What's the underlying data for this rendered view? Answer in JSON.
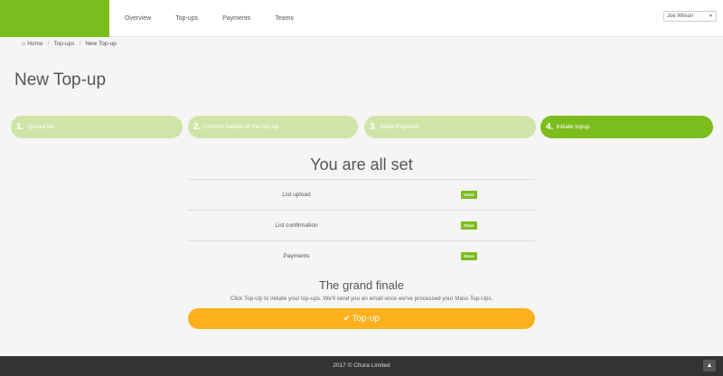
{
  "nav": {
    "items": [
      "Overview",
      "Top-ups",
      "Payments",
      "Teams"
    ]
  },
  "user": {
    "name": "Joe Wilson"
  },
  "breadcrumb": {
    "home": "Home",
    "section": "Top-ups",
    "current": "New Top-up"
  },
  "page": {
    "title": "New Top-up"
  },
  "steps": [
    {
      "num": "1.",
      "label": "Upload list"
    },
    {
      "num": "2.",
      "label": "Confirm Details of the top-up"
    },
    {
      "num": "3.",
      "label": "Make Payment"
    },
    {
      "num": "4.",
      "label": "Initiate topup"
    }
  ],
  "status": {
    "title": "You are all set",
    "rows": [
      {
        "label": "List upload",
        "badge": "Done"
      },
      {
        "label": "List confirmation",
        "badge": "Done"
      },
      {
        "label": "Payments",
        "badge": "Done"
      }
    ]
  },
  "finale": {
    "title": "The grand finale",
    "description": "Click Top-Up to initiate your top-ups. We'll send you an email once we've processed your Mass Top-Ups.",
    "button": "Top-up"
  },
  "footer": {
    "text": "2017 © Chura Limited"
  },
  "colors": {
    "brand": "#7cbd1e",
    "step_inactive": "#cfe5a7",
    "button": "#fbb01c",
    "footer": "#333333"
  },
  "icons": {
    "home": "home-icon",
    "check": "check-icon",
    "caret": "chevron-down-icon",
    "scroll": "chevron-up-icon"
  }
}
